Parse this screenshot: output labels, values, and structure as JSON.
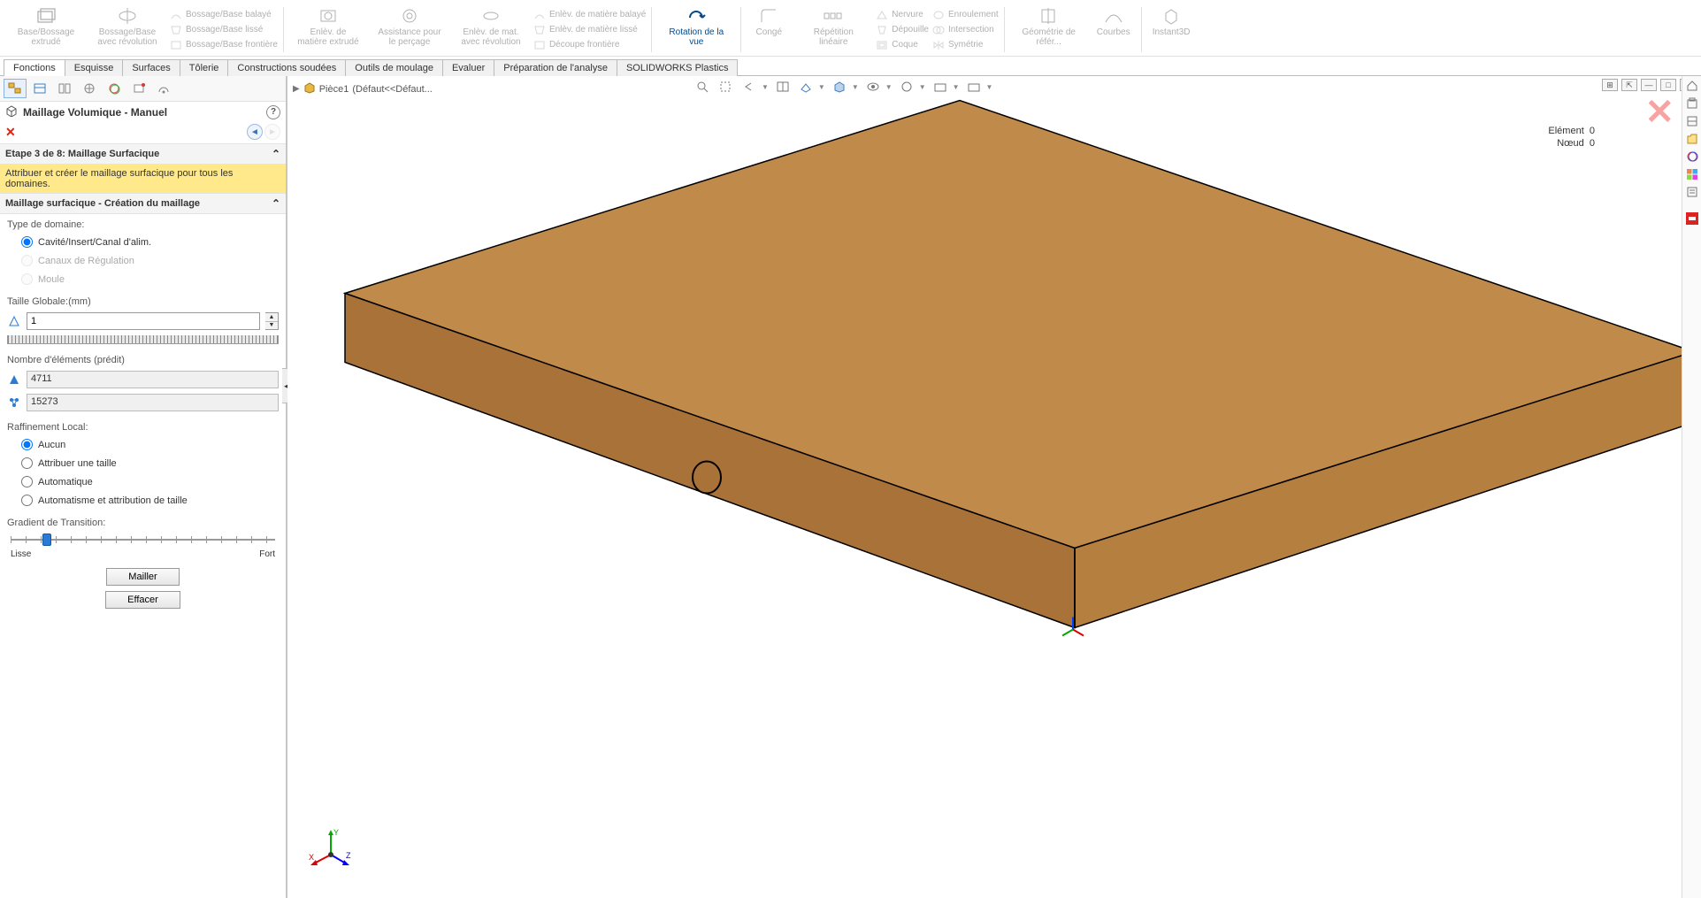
{
  "ribbon": {
    "items": [
      {
        "label": "Base/Bossage\nextrudé"
      },
      {
        "label": "Bossage/Base avec révolution"
      },
      {
        "label": "Bossage/Base balayé"
      },
      {
        "label": "Bossage/Base lissé"
      },
      {
        "label": "Bossage/Base frontière"
      },
      {
        "label": "Enlèv. de matière extrudé"
      },
      {
        "label": "Assistance pour le perçage"
      },
      {
        "label": "Enlèv. de mat. avec révolution"
      },
      {
        "label": "Enlèv. de matière balayé"
      },
      {
        "label": "Enlèv. de matière lissé"
      },
      {
        "label": "Découpe frontière"
      },
      {
        "label": "Rotation de la vue",
        "active": true
      },
      {
        "label": "Congé"
      },
      {
        "label": "Répétition linéaire"
      },
      {
        "label": "Nervure"
      },
      {
        "label": "Dépouille"
      },
      {
        "label": "Coque"
      },
      {
        "label": "Enroulement"
      },
      {
        "label": "Intersection"
      },
      {
        "label": "Symétrie"
      },
      {
        "label": "Géométrie de référ..."
      },
      {
        "label": "Courbes"
      },
      {
        "label": "Instant3D"
      }
    ]
  },
  "cmtabs": [
    "Fonctions",
    "Esquisse",
    "Surfaces",
    "Tôlerie",
    "Constructions soudées",
    "Outils de moulage",
    "Evaluer",
    "Préparation de l'analyse",
    "SOLIDWORKS Plastics"
  ],
  "cmtab_active": 0,
  "breadcrumb": {
    "part": "Pièce1",
    "config": "(Défaut<<Défaut..."
  },
  "panel": {
    "title": "Maillage Volumique - Manuel",
    "step_header": "Etape 3 de 8: Maillage Surfacique",
    "hint": "Attribuer et créer le maillage surfacique pour tous les domaines.",
    "surface_header": "Maillage surfacique - Création du maillage",
    "domain_type_label": "Type de domaine:",
    "domain_options": {
      "cavity": "Cavité/Insert/Canal d'alim.",
      "cooling": "Canaux de Régulation",
      "mold": "Moule"
    },
    "global_size_label": "Taille Globale:(mm)",
    "global_size_value": "1",
    "elem_pred_label": "Nombre d'éléments (prédit)",
    "elem_pred_tri": "4711",
    "elem_pred_nodes": "15273",
    "refine_label": "Raffinement Local:",
    "refine_options": {
      "none": "Aucun",
      "assign": "Attribuer une taille",
      "auto": "Automatique",
      "auto_assign": "Automatisme et attribution de taille"
    },
    "gradient_label": "Gradient de Transition:",
    "gradient_left": "Lisse",
    "gradient_right": "Fort",
    "btn_mesh": "Mailler",
    "btn_clear": "Effacer"
  },
  "stats": {
    "element_label": "Elément",
    "element_val": "0",
    "node_label": "Nœud",
    "node_val": "0"
  }
}
